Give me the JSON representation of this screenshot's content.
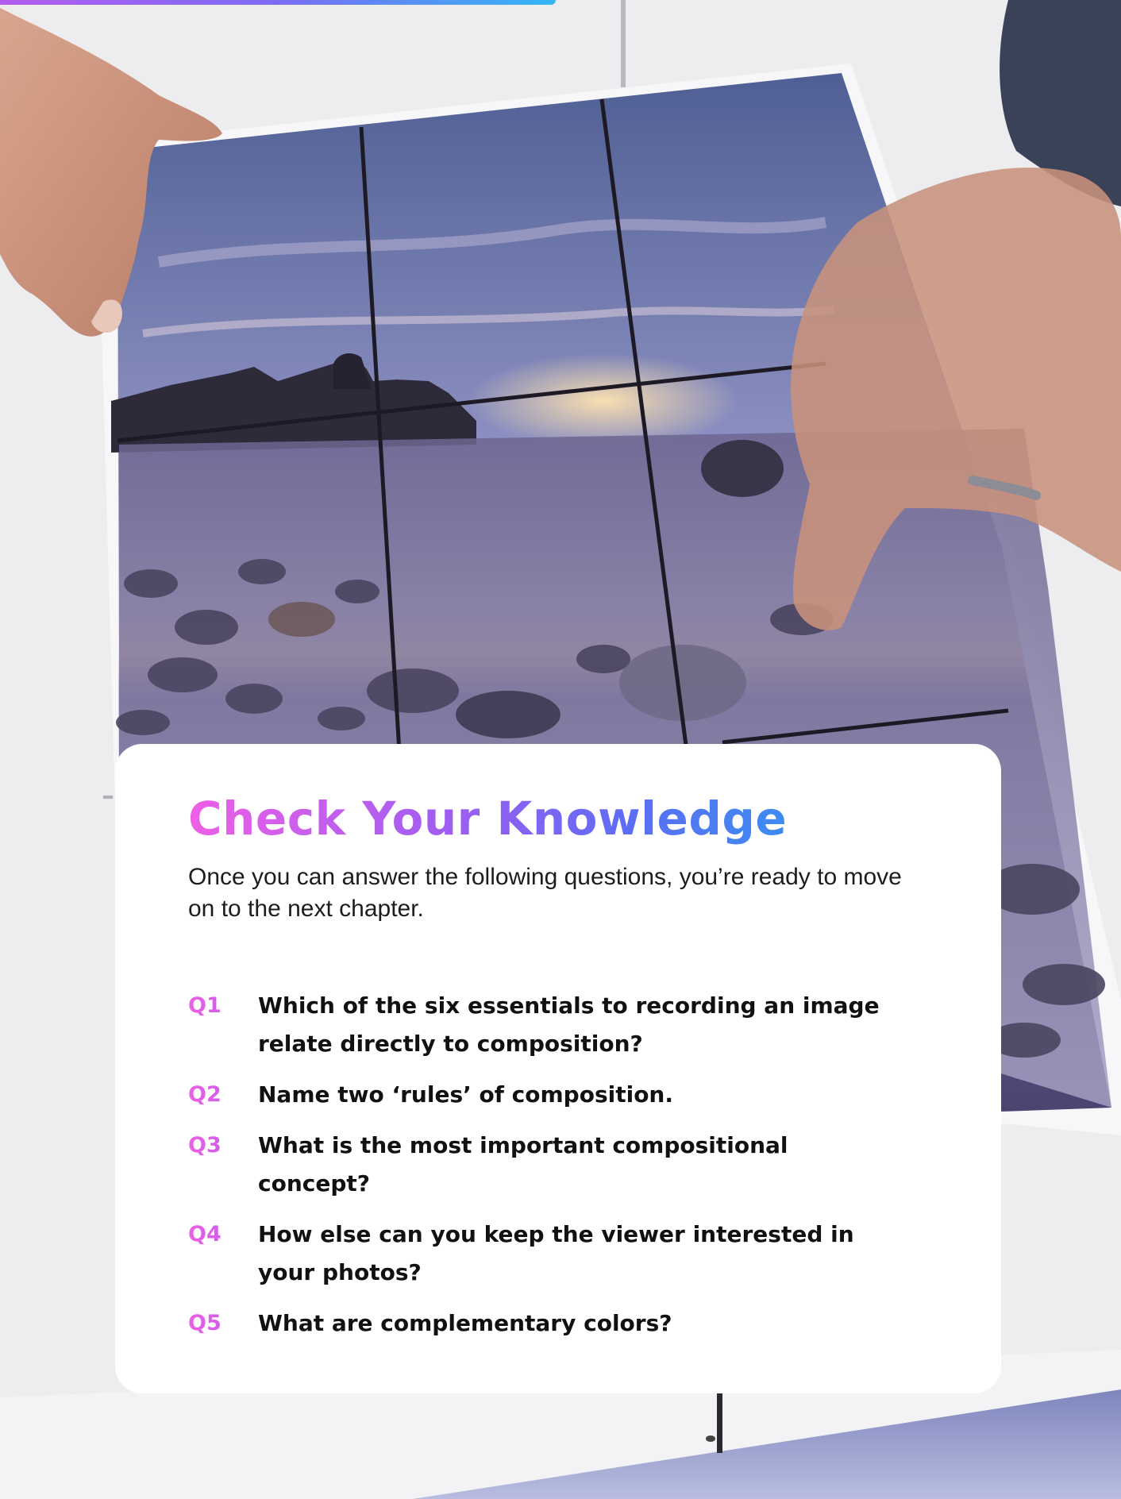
{
  "colors": {
    "accent_pink": "#ee5fe6",
    "accent_purple": "#9c5df2",
    "accent_blue": "#3d8cf0",
    "card_background": "#ffffff",
    "body_text": "#1d1d1f"
  },
  "card": {
    "title": "Check Your Knowledge",
    "intro": "Once you can answer the following questions, you’re ready to move on to the next chapter.",
    "questions": [
      {
        "number": "Q1",
        "text": "Which of the six essentials to recording an image relate directly to composition?"
      },
      {
        "number": "Q2",
        "text": "Name two ‘rules’ of composition."
      },
      {
        "number": "Q3",
        "text": "What is the most important compositional concept?"
      },
      {
        "number": "Q4",
        "text": "How else can you keep the viewer interested in your photos?"
      },
      {
        "number": "Q5",
        "text": "What are complementary colors?"
      }
    ]
  }
}
